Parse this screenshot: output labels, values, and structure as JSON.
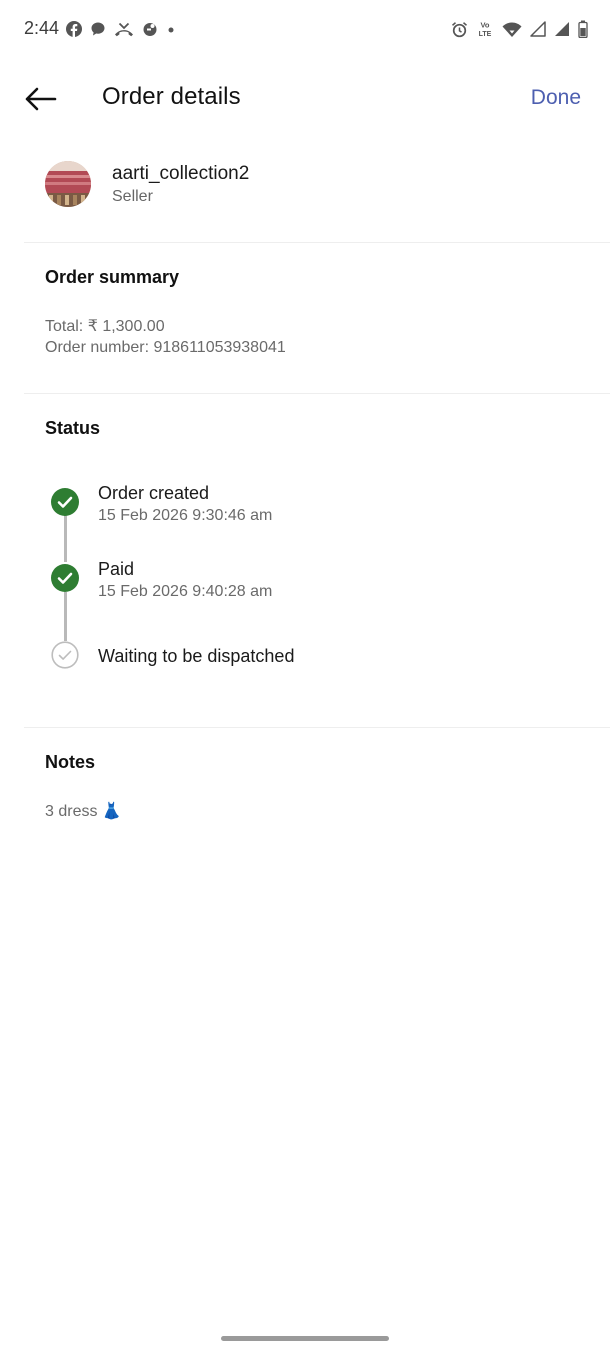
{
  "status_bar": {
    "time": "2:44",
    "left_icons": [
      "facebook-icon",
      "chat-icon",
      "missed-call-icon",
      "app-notification-icon",
      "more-dot-icon"
    ],
    "right_icons": [
      "alarm-icon",
      "volte-icon",
      "wifi-icon",
      "signal-icon",
      "signal-icon",
      "battery-icon"
    ],
    "volte_label": "VoLTE"
  },
  "header": {
    "title": "Order details",
    "done_label": "Done"
  },
  "seller": {
    "name": "aarti_collection2",
    "role": "Seller"
  },
  "order_summary": {
    "heading": "Order summary",
    "total": "Total: ₹ 1,300.00",
    "order_number": "Order number: 918611053938041"
  },
  "status": {
    "heading": "Status",
    "steps": [
      {
        "title": "Order created",
        "time": "15 Feb 2026 9:30:46 am",
        "completed": true
      },
      {
        "title": "Paid",
        "time": "15 Feb 2026 9:40:28 am",
        "completed": true
      },
      {
        "title": "Waiting to be dispatched",
        "time": "",
        "completed": false
      }
    ]
  },
  "notes": {
    "heading": "Notes",
    "text": "3 dress 👗"
  },
  "colors": {
    "accent": "#4d5fb0",
    "success": "#2e7d32",
    "pending": "#bdbdbd"
  }
}
